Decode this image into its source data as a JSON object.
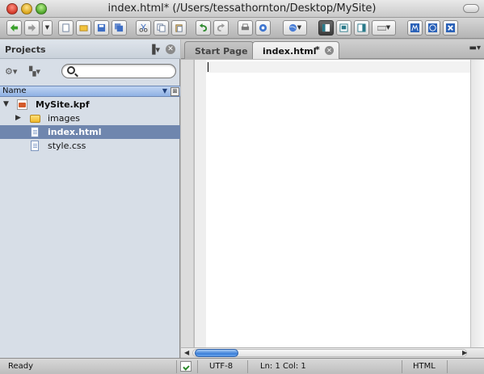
{
  "window": {
    "title": "index.html* (/Users/tessathornton/Desktop/MySite)"
  },
  "toolbar": {
    "buttons": [
      {
        "name": "back-icon"
      },
      {
        "name": "forward-icon"
      },
      {
        "name": "history-dropdown-icon"
      },
      {
        "name": "new-file-icon"
      },
      {
        "name": "open-folder-icon"
      },
      {
        "name": "save-icon"
      },
      {
        "name": "save-all-icon"
      },
      {
        "name": "cut-icon"
      },
      {
        "name": "copy-icon"
      },
      {
        "name": "paste-icon"
      },
      {
        "name": "undo-icon"
      },
      {
        "name": "redo-icon"
      },
      {
        "name": "print-icon"
      },
      {
        "name": "preview-icon"
      },
      {
        "name": "browser-icon"
      },
      {
        "name": "left-pane-toggle-icon"
      },
      {
        "name": "right-pane-toggle-icon"
      },
      {
        "name": "bottom-pane-toggle-icon"
      },
      {
        "name": "toolbox-icon"
      },
      {
        "name": "komodo-icon"
      },
      {
        "name": "web-icon"
      },
      {
        "name": "debug-icon"
      }
    ]
  },
  "projects_pane": {
    "title": "Projects",
    "search": {
      "value": "",
      "placeholder": ""
    },
    "column_header": "Name",
    "tree": [
      {
        "label": "MySite.kpf",
        "type": "project",
        "expanded": true
      },
      {
        "label": "images",
        "type": "folder",
        "expanded": false
      },
      {
        "label": "index.html",
        "type": "file",
        "selected": true
      },
      {
        "label": "style.css",
        "type": "file"
      }
    ]
  },
  "editor": {
    "tabs": [
      {
        "label": "Start Page",
        "active": false
      },
      {
        "label": "index.html",
        "active": true,
        "dirty": "*"
      }
    ],
    "content": ""
  },
  "statusbar": {
    "status": "Ready",
    "encoding": "UTF-8",
    "position": "Ln: 1 Col: 1",
    "language": "HTML"
  },
  "colors": {
    "selection": "#6f86ae",
    "column_header": "#9db9e6",
    "scroll_thumb": "#3c7fd8"
  }
}
